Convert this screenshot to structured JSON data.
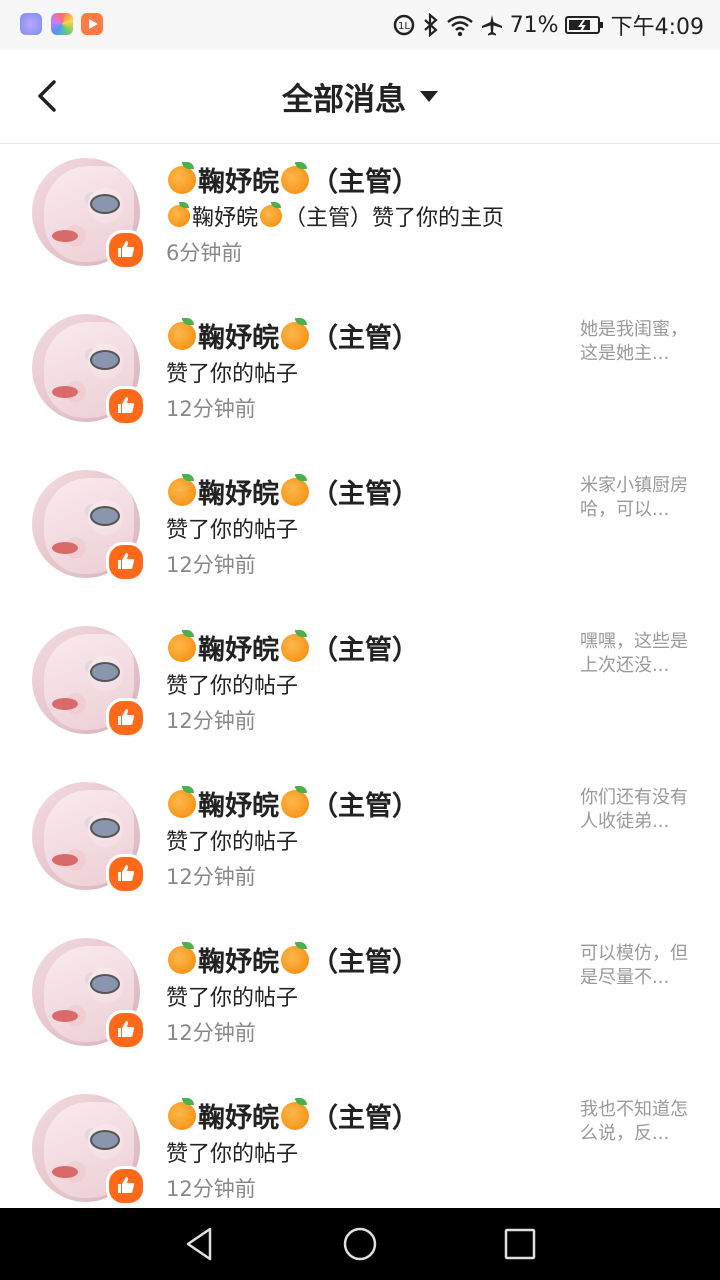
{
  "status_bar": {
    "battery": "71%",
    "time": "下午4:09"
  },
  "header": {
    "title": "全部消息"
  },
  "notifications": [
    {
      "name": "鞠妤皖",
      "role": "（主管）",
      "action_prefix": "鞠妤皖",
      "action": "（主管）赞了你的主页",
      "time": "6分钟前",
      "snippet": ""
    },
    {
      "name": "鞠妤皖",
      "role": "（主管）",
      "action_prefix": "",
      "action": "赞了你的帖子",
      "time": "12分钟前",
      "snippet": "她是我闺蜜，这是她主..."
    },
    {
      "name": "鞠妤皖",
      "role": "（主管）",
      "action_prefix": "",
      "action": "赞了你的帖子",
      "time": "12分钟前",
      "snippet": "米家小镇厨房哈，可以..."
    },
    {
      "name": "鞠妤皖",
      "role": "（主管）",
      "action_prefix": "",
      "action": "赞了你的帖子",
      "time": "12分钟前",
      "snippet": "嘿嘿，这些是上次还没..."
    },
    {
      "name": "鞠妤皖",
      "role": "（主管）",
      "action_prefix": "",
      "action": "赞了你的帖子",
      "time": "12分钟前",
      "snippet": "你们还有没有人收徒弟..."
    },
    {
      "name": "鞠妤皖",
      "role": "（主管）",
      "action_prefix": "",
      "action": "赞了你的帖子",
      "time": "12分钟前",
      "snippet": "可以模仿，但是尽量不..."
    },
    {
      "name": "鞠妤皖",
      "role": "（主管）",
      "action_prefix": "",
      "action": "赞了你的帖子",
      "time": "12分钟前",
      "snippet": "我也不知道怎么说，反..."
    }
  ],
  "colors": {
    "accent": "#ff6a1a",
    "secondary_text": "#888888"
  }
}
